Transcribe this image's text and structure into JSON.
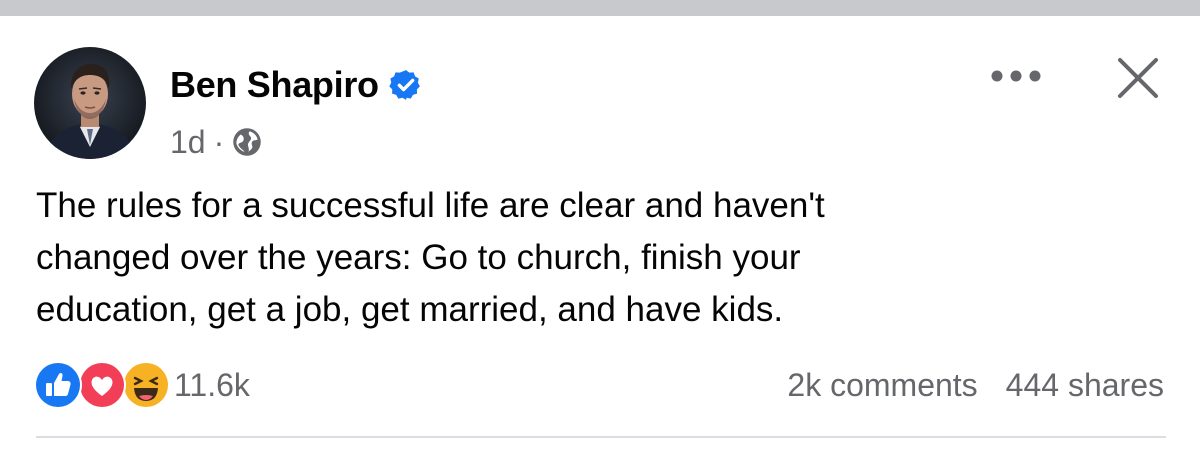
{
  "post": {
    "author": "Ben Shapiro",
    "verified": true,
    "time": "1d",
    "separator": "·",
    "audience_icon": "globe-icon",
    "text_lines": [
      "The rules for a successful life are clear and haven't",
      "changed over the years: Go to church, finish your",
      "education, get a job, get married, and have kids."
    ]
  },
  "header": {
    "more_icon": "more-horizontal-icon",
    "close_icon": "close-icon"
  },
  "reactions": {
    "icons": [
      "like-icon",
      "love-icon",
      "haha-icon"
    ],
    "count": "11.6k"
  },
  "stats": {
    "comments": "2k comments",
    "shares": "444 shares"
  },
  "colors": {
    "verified_blue": "#1877f2",
    "like_blue": "#1877f2",
    "love_red": "#f33e58",
    "haha_yellow": "#f7b125",
    "secondary_text": "#65676b",
    "primary_text": "#050505",
    "top_band": "#c8c9cc"
  }
}
